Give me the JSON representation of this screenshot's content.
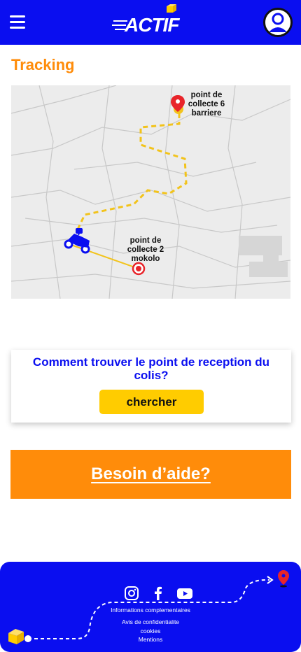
{
  "header": {
    "logo_text": "ACTIF"
  },
  "page": {
    "title": "Tracking"
  },
  "map": {
    "destination_label_line1": "point de",
    "destination_label_line2": "collecte 6",
    "destination_label_line3": "barriere",
    "origin_label_line1": "point de",
    "origin_label_line2": "collecte 2",
    "origin_label_line3": "mokolo",
    "route_color": "#f2c31b",
    "pin_color": "#e8242a"
  },
  "help": {
    "question": "Comment trouver le  point de reception du colis?",
    "search_label": "chercher"
  },
  "need_help": {
    "label": "Besoin d’aide?"
  },
  "footer": {
    "links": [
      "Informations complementaires",
      "Avis de confidentialite",
      "cookies",
      "Mentions"
    ]
  },
  "colors": {
    "brand_blue": "#0a0ef0",
    "accent_orange": "#ff8c0a",
    "button_yellow": "#ffcc00"
  }
}
